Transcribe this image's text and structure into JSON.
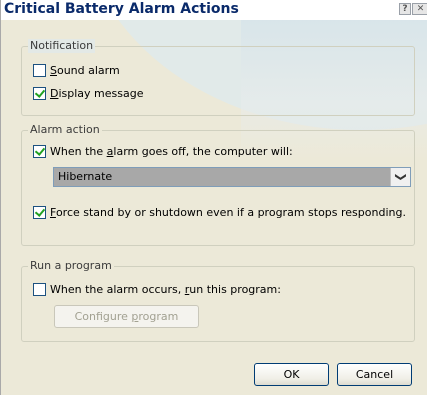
{
  "window": {
    "title": "Critical Battery Alarm Actions",
    "help_glyph": "?",
    "close_glyph": "✕"
  },
  "notification": {
    "legend": "Notification",
    "sound_alarm": {
      "prefix": "",
      "accel": "S",
      "suffix": "ound alarm",
      "checked": false
    },
    "display_message": {
      "prefix": "",
      "accel": "D",
      "suffix": "isplay message",
      "checked": true
    }
  },
  "alarm_action": {
    "legend": "Alarm action",
    "when_alarm": {
      "prefix": "When the ",
      "accel": "a",
      "suffix": "larm goes off, the computer will:",
      "checked": true
    },
    "action_select": {
      "value": "Hibernate",
      "arrow_glyph": "❯"
    },
    "force_standby": {
      "prefix": "",
      "accel": "F",
      "suffix": "orce stand by or shutdown even if a program stops responding.",
      "checked": true
    }
  },
  "run_program": {
    "legend": "Run a program",
    "when_occurs": {
      "prefix": "When the alarm occurs, ",
      "accel": "r",
      "suffix": "un this program:",
      "checked": false
    },
    "configure_button": {
      "prefix": "Configure ",
      "accel": "p",
      "suffix": "rogram",
      "enabled": false
    }
  },
  "buttons": {
    "ok": "OK",
    "cancel": "Cancel"
  },
  "colors": {
    "title": "#0a2a6a",
    "face": "#ece9d8",
    "check_mark": "#21a121",
    "selected_bg": "#a8a8a8"
  }
}
